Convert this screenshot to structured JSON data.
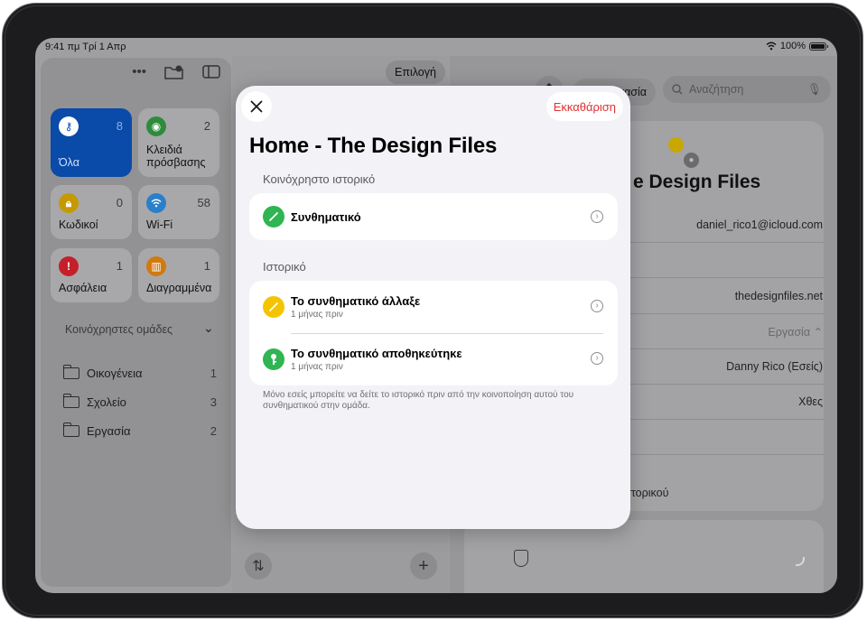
{
  "status_bar": {
    "time_date": "9:41 πμ  Τρί 1 Απρ",
    "battery": "100%"
  },
  "sidebar": {
    "tiles": [
      {
        "label": "Όλα",
        "count": "8",
        "icon": "key-icon",
        "color": "#0a4aa8"
      },
      {
        "label": "Κλειδιά πρόσβασης",
        "count": "2",
        "icon": "passkey-icon",
        "color": "#2e8b3c"
      },
      {
        "label": "Κωδικοί",
        "count": "0",
        "icon": "code-lock-icon",
        "color": "#c59a00"
      },
      {
        "label": "Wi-Fi",
        "count": "58",
        "icon": "wifi-icon",
        "color": "#2a7fc9"
      },
      {
        "label": "Ασφάλεια",
        "count": "1",
        "icon": "alert-icon",
        "color": "#c4202a"
      },
      {
        "label": "Διαγραμμένα",
        "count": "1",
        "icon": "trash-icon",
        "color": "#d07a10"
      }
    ],
    "shared_groups_header": "Κοινόχρηστες ομάδες",
    "groups": [
      {
        "name": "Οικογένεια",
        "count": "1"
      },
      {
        "name": "Σχολείο",
        "count": "3"
      },
      {
        "name": "Εργασία",
        "count": "2"
      }
    ]
  },
  "middle": {
    "select_label": "Επιλογή"
  },
  "detail": {
    "edit_label": "Επεξεργασία",
    "search_placeholder": "Αναζήτηση",
    "title_fragment": "e Design Files",
    "email": "daniel_rico1@icloud.com",
    "website": "thedesignfiles.net",
    "group_value": "Εργασία ⌃",
    "owner": "Danny Rico (Εσείς)",
    "modified": "Χθες",
    "history_fragment": "ή ιστορικού"
  },
  "modal": {
    "clear_label": "Εκκαθάριση",
    "title": "Home - The Design Files",
    "shared_history_header": "Κοινόχρηστο ιστορικό",
    "shared_rows": [
      {
        "title": "Συνθηματικό",
        "icon": "pencil-icon",
        "color": "#2fb552"
      }
    ],
    "history_header": "Ιστορικό",
    "history_rows": [
      {
        "title": "Το συνθηματικό άλλαξε",
        "subtitle": "1 μήνας πριν",
        "icon": "pencil-icon",
        "color": "#f5c400"
      },
      {
        "title": "Το συνθηματικό αποθηκεύτηκε",
        "subtitle": "1 μήνας πριν",
        "icon": "key-icon",
        "color": "#2fb552"
      }
    ],
    "footnote": "Μόνο εσείς μπορείτε να δείτε το ιστορικό πριν από την κοινοποίηση αυτού του συνθηματικού στην ομάδα."
  }
}
